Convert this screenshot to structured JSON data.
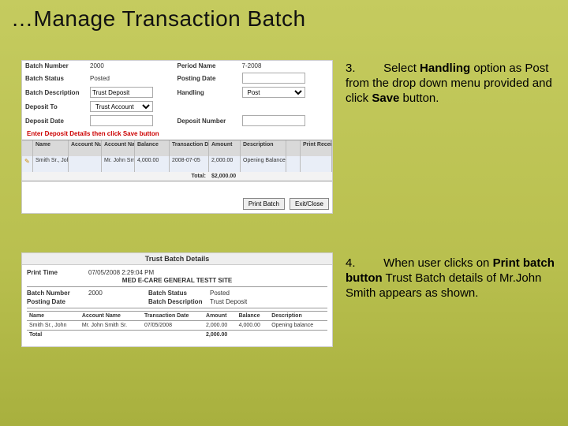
{
  "slide_title": "…Manage Transaction Batch",
  "instructions": {
    "step3": {
      "num": "3.",
      "prefix": "Select ",
      "bold1": "Handling",
      "mid": " option as Post from the drop down menu provided and click ",
      "bold2": "Save",
      "suffix": " button."
    },
    "step4": {
      "num": "4.",
      "prefix": "When user clicks on ",
      "bold1": "Print batch button",
      "mid": " Trust Batch details of Mr.John Smith appears as shown.",
      "bold2": "",
      "suffix": ""
    }
  },
  "shot1": {
    "fields": {
      "batch_number_lbl": "Batch Number",
      "batch_number_val": "2000",
      "period_name_lbl": "Period Name",
      "period_name_val": "7-2008",
      "batch_status_lbl": "Batch Status",
      "batch_status_val": "Posted",
      "posting_date_lbl": "Posting Date",
      "posting_date_val": "",
      "batch_desc_lbl": "Batch Description",
      "batch_desc_val": "Trust Deposit",
      "handling_lbl": "Handling",
      "handling_val": "Post",
      "deposit_to_lbl": "Deposit To",
      "deposit_to_val": "Trust Account",
      "deposit_date_lbl": "Deposit Date",
      "deposit_date_val": "",
      "deposit_num_lbl": "Deposit Number",
      "deposit_num_val": ""
    },
    "red_instruction": "Enter Deposit Details then click Save button",
    "grid_headers": {
      "name": "Name",
      "acct_no": "Account Number",
      "acct_name": "Account Name",
      "balance": "Balance",
      "txn_date": "Transaction Date",
      "amount": "Amount",
      "desc": "Description",
      "receipt": "Print Receipt"
    },
    "grid_row": {
      "name": "Smith Sr., John",
      "acct_no": "",
      "acct_name": "Mr. John Smith Sr.",
      "balance": "4,000.00",
      "txn_date": "2008-07-05",
      "amount": "2,000.00",
      "desc": "Opening Balance"
    },
    "total_label": "Total:",
    "total_value": "$2,000.00",
    "buttons": {
      "print": "Print Batch",
      "close": "Exit/Close"
    }
  },
  "shot2": {
    "window_title": "Trust Batch Details",
    "site": "MED E-CARE GENERAL TESTT SITE",
    "print_time_lbl": "Print Time",
    "print_time_val": "07/05/2008  2:29:04 PM",
    "meta": {
      "batch_number_lbl": "Batch Number",
      "batch_number_val": "2000",
      "batch_status_lbl": "Batch Status",
      "batch_status_val": "Posted",
      "posting_date_lbl": "Posting Date",
      "posting_date_val": "",
      "batch_desc_lbl": "Batch Description",
      "batch_desc_val": "Trust Deposit"
    },
    "table": {
      "headers": {
        "name": "Name",
        "acct": "Account Name",
        "date": "Transaction Date",
        "amount": "Amount",
        "bal": "Balance",
        "desc": "Description"
      },
      "row": {
        "name": "Smith Sr., John",
        "acct": "Mr. John Smith Sr.",
        "date": "07/05/2008",
        "amount": "2,000.00",
        "bal": "4,000.00",
        "desc": "Opening balance"
      },
      "total_lbl": "Total",
      "total_val": "2,000.00"
    }
  }
}
